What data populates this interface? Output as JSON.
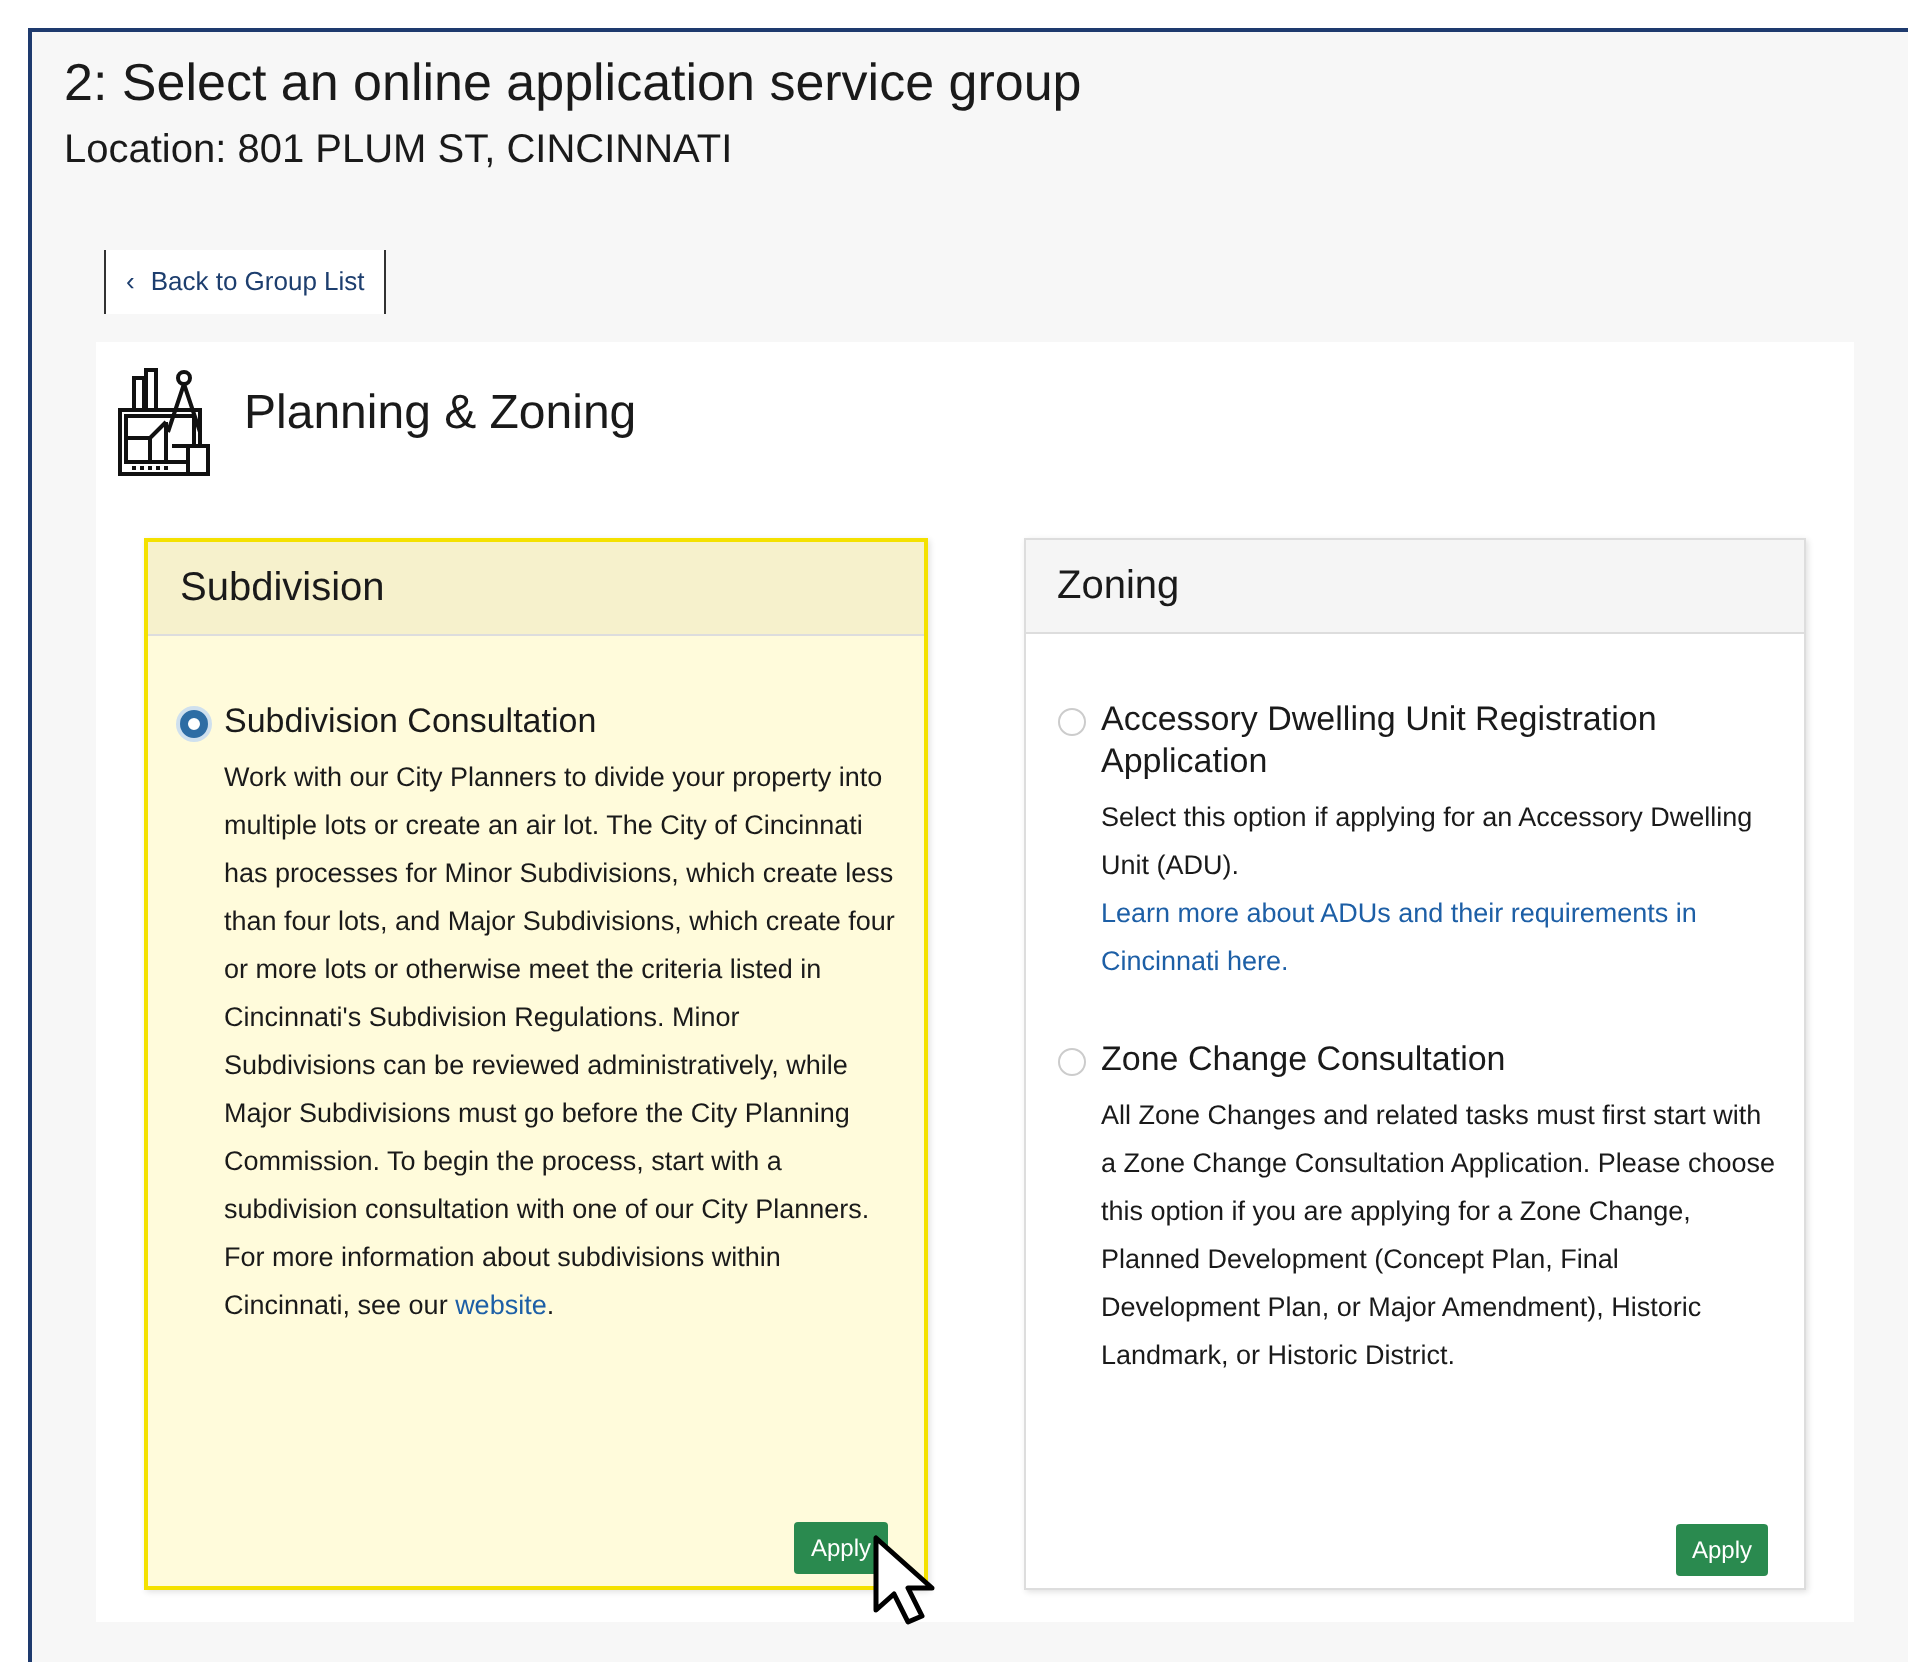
{
  "heading": "2: Select an online application service group",
  "location": "Location: 801 PLUM ST, CINCINNATI",
  "back_button": {
    "icon": "‹",
    "label": "Back to Group List"
  },
  "category": {
    "title": "Planning & Zoning"
  },
  "groups": [
    {
      "title": "Subdivision",
      "selected": true,
      "button": "Apply",
      "options": [
        {
          "title": "Subdivision Consultation",
          "selected": true,
          "description": [
            {
              "kind": "text",
              "text": "Work with our City Planners to divide your property into multiple lots or create an air lot. The City of Cincinnati has processes for Minor Subdivisions, which create less than four lots, and Major Subdivisions, which create four or more lots or otherwise meet the criteria listed in Cincinnati's Subdivision Regulations. Minor Subdivisions can be reviewed administratively, while Major Subdivisions must go before the City Planning Commission. To begin the process, start with a subdivision consultation with one of our City Planners. For more information about subdivisions within Cincinnati, see our "
            },
            {
              "kind": "link",
              "text": "website"
            },
            {
              "kind": "text",
              "text": "."
            }
          ]
        }
      ]
    },
    {
      "title": "Zoning",
      "selected": false,
      "button": "Apply",
      "options": [
        {
          "title": "Accessory Dwelling Unit Registration Application",
          "selected": false,
          "description": [
            {
              "kind": "text",
              "text": "Select this option if applying for an Accessory Dwelling Unit (ADU). "
            },
            {
              "kind": "link",
              "text": "Learn more about ADUs and their requirements in Cincinnati here."
            }
          ]
        },
        {
          "title": "Zone Change Consultation",
          "selected": false,
          "description": [
            {
              "kind": "text",
              "text": "All Zone Changes and related tasks must first start with a Zone Change Consultation Application. Please choose this option if you are applying for a Zone Change, Planned Development (Concept Plan, Final Development Plan, or Major Amendment), Historic Landmark, or Historic District."
            }
          ]
        }
      ]
    }
  ]
}
